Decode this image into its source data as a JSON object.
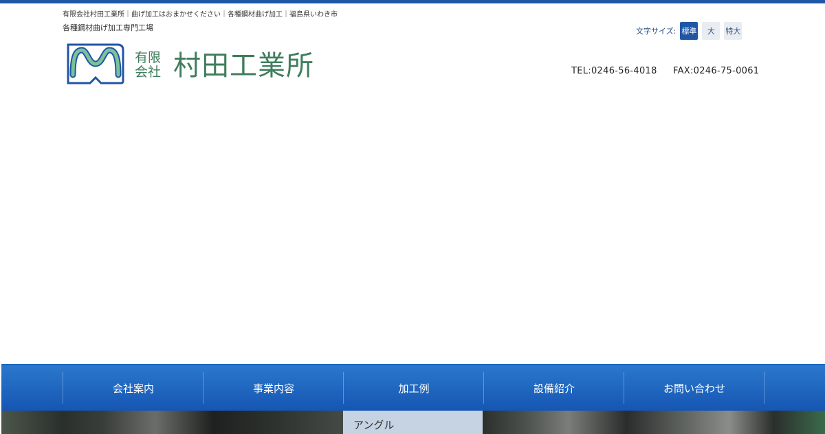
{
  "header": {
    "tagline": "有限会社村田工業所｜曲げ加工はおまかせください｜各種鋼材曲げ加工｜福島県いわき市",
    "subtitle": "各種鋼材曲げ加工専門工場",
    "logo": {
      "prefix_top": "有限",
      "prefix_bottom": "会社",
      "name": "村田工業所"
    },
    "font_size": {
      "label": "文字サイズ:",
      "options": [
        "標準",
        "大",
        "特大"
      ],
      "selected": "標準"
    },
    "tel": "TEL:0246-56-4018",
    "fax": "FAX:0246-75-0061"
  },
  "nav": {
    "items": [
      "会社案内",
      "事業内容",
      "加工例",
      "設備紹介",
      "お問い合わせ"
    ]
  },
  "banner": {
    "caption": "アングル"
  },
  "colors": {
    "brand_blue": "#1f56a6",
    "logo_green": "#3f7d5c",
    "nav_top": "#2b78cc",
    "nav_bottom": "#1556b3"
  }
}
